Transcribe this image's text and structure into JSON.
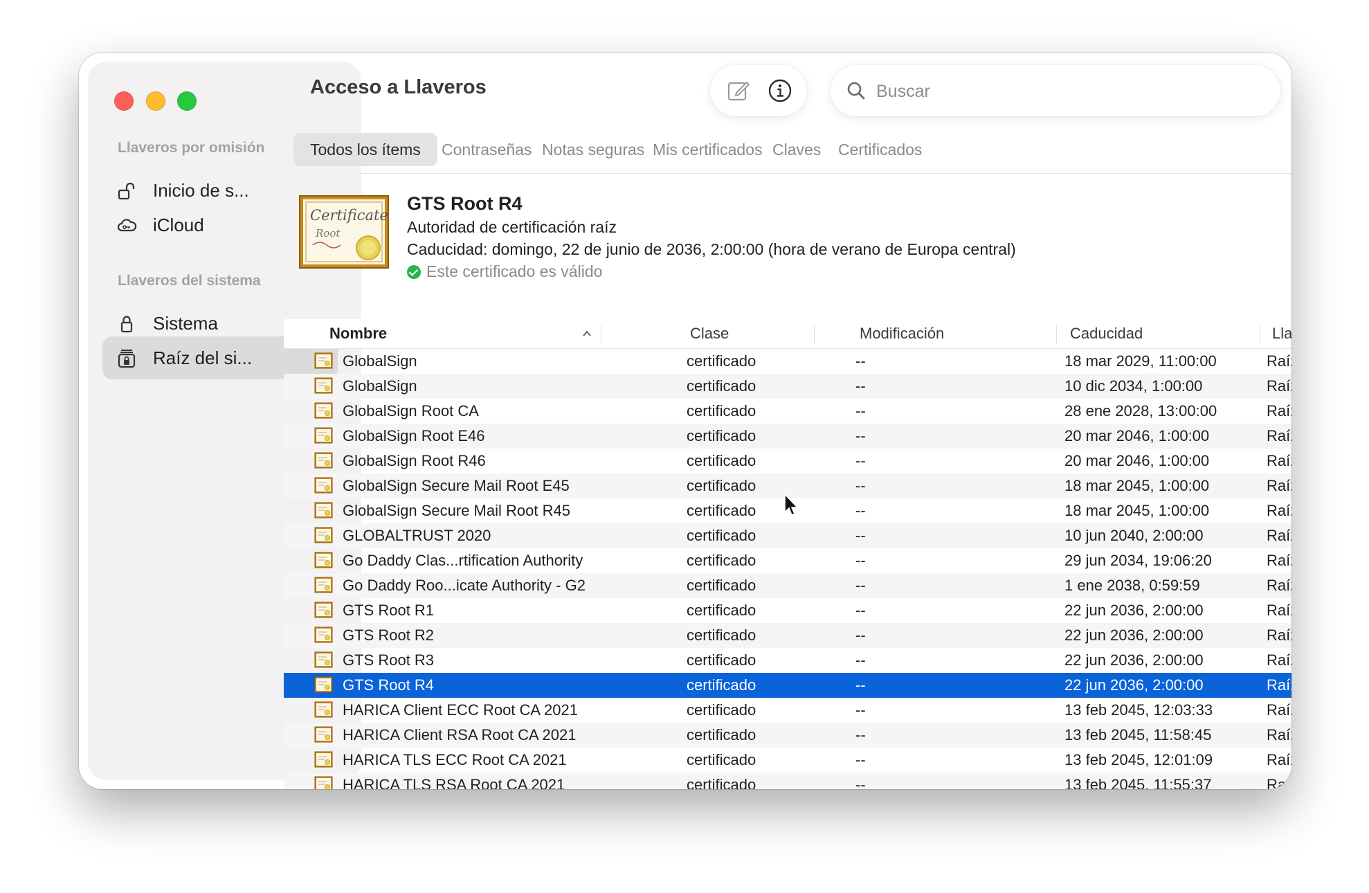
{
  "window": {
    "title": "Acceso a Llaveros"
  },
  "sidebar": {
    "default_section": "Llaveros por omisión",
    "system_section": "Llaveros del sistema",
    "items": [
      {
        "label": "Inicio de s...",
        "icon": "lock-open-icon",
        "selected": false
      },
      {
        "label": "iCloud",
        "icon": "cloud-icon",
        "selected": false
      },
      {
        "label": "Sistema",
        "icon": "lock-icon",
        "selected": false
      },
      {
        "label": "Raíz del si...",
        "icon": "lock-cabinet-icon",
        "selected": true
      }
    ]
  },
  "toolbar": {
    "edit_icon": "compose-icon",
    "info_icon": "info-icon"
  },
  "search": {
    "placeholder": "Buscar",
    "value": ""
  },
  "tabs": [
    {
      "label": "Todos los ítems",
      "active": true
    },
    {
      "label": "Contraseñas",
      "active": false
    },
    {
      "label": "Notas seguras",
      "active": false
    },
    {
      "label": "Mis certificados",
      "active": false
    },
    {
      "label": "Claves",
      "active": false
    },
    {
      "label": "Certificados",
      "active": false
    }
  ],
  "detail": {
    "icon_text_1": "Certificate",
    "icon_text_2": "Root",
    "name": "GTS Root R4",
    "kind": "Autoridad de certificación raíz",
    "expiry": "Caducidad: domingo, 22 de junio de 2036, 2:00:00 (hora de verano de Europa central)",
    "validity": "Este certificado es válido",
    "validity_color": "#29b34a"
  },
  "table": {
    "columns": [
      "Nombre",
      "Clase",
      "Modificación",
      "Caducidad",
      "Llavero"
    ],
    "sort_column": "Nombre",
    "sort_direction": "ascending",
    "selected_color": "#0a63d9",
    "rows": [
      {
        "name": "GlobalSign",
        "class": "certificado",
        "modified": "--",
        "expires": "18 mar 2029, 11:00:00",
        "keychain": "Raíz del sist..."
      },
      {
        "name": "GlobalSign",
        "class": "certificado",
        "modified": "--",
        "expires": "10 dic 2034, 1:00:00",
        "keychain": "Raíz del sist..."
      },
      {
        "name": "GlobalSign Root CA",
        "class": "certificado",
        "modified": "--",
        "expires": "28 ene 2028, 13:00:00",
        "keychain": "Raíz del sist..."
      },
      {
        "name": "GlobalSign Root E46",
        "class": "certificado",
        "modified": "--",
        "expires": "20 mar 2046, 1:00:00",
        "keychain": "Raíz del sist..."
      },
      {
        "name": "GlobalSign Root R46",
        "class": "certificado",
        "modified": "--",
        "expires": "20 mar 2046, 1:00:00",
        "keychain": "Raíz del sist..."
      },
      {
        "name": "GlobalSign Secure Mail Root E45",
        "class": "certificado",
        "modified": "--",
        "expires": "18 mar 2045, 1:00:00",
        "keychain": "Raíz del sist..."
      },
      {
        "name": "GlobalSign Secure Mail Root R45",
        "class": "certificado",
        "modified": "--",
        "expires": "18 mar 2045, 1:00:00",
        "keychain": "Raíz del sist..."
      },
      {
        "name": "GLOBALTRUST 2020",
        "class": "certificado",
        "modified": "--",
        "expires": "10 jun 2040, 2:00:00",
        "keychain": "Raíz del sist..."
      },
      {
        "name": "Go Daddy Clas...rtification Authority",
        "class": "certificado",
        "modified": "--",
        "expires": "29 jun 2034, 19:06:20",
        "keychain": "Raíz del sist..."
      },
      {
        "name": "Go Daddy Roo...icate Authority - G2",
        "class": "certificado",
        "modified": "--",
        "expires": "1 ene 2038, 0:59:59",
        "keychain": "Raíz del sist..."
      },
      {
        "name": "GTS Root R1",
        "class": "certificado",
        "modified": "--",
        "expires": "22 jun 2036, 2:00:00",
        "keychain": "Raíz del sist..."
      },
      {
        "name": "GTS Root R2",
        "class": "certificado",
        "modified": "--",
        "expires": "22 jun 2036, 2:00:00",
        "keychain": "Raíz del sist..."
      },
      {
        "name": "GTS Root R3",
        "class": "certificado",
        "modified": "--",
        "expires": "22 jun 2036, 2:00:00",
        "keychain": "Raíz del sist..."
      },
      {
        "name": "GTS Root R4",
        "class": "certificado",
        "modified": "--",
        "expires": "22 jun 2036, 2:00:00",
        "keychain": "Raíz del sist...",
        "selected": true
      },
      {
        "name": "HARICA Client ECC Root CA 2021",
        "class": "certificado",
        "modified": "--",
        "expires": "13 feb 2045, 12:03:33",
        "keychain": "Raíz del sist..."
      },
      {
        "name": "HARICA Client RSA Root CA 2021",
        "class": "certificado",
        "modified": "--",
        "expires": "13 feb 2045, 11:58:45",
        "keychain": "Raíz del sist..."
      },
      {
        "name": "HARICA TLS ECC Root CA 2021",
        "class": "certificado",
        "modified": "--",
        "expires": "13 feb 2045, 12:01:09",
        "keychain": "Raíz del sist..."
      },
      {
        "name": "HARICA TLS RSA Root CA 2021",
        "class": "certificado",
        "modified": "--",
        "expires": "13 feb 2045, 11:55:37",
        "keychain": "Raíz del si..."
      }
    ]
  }
}
